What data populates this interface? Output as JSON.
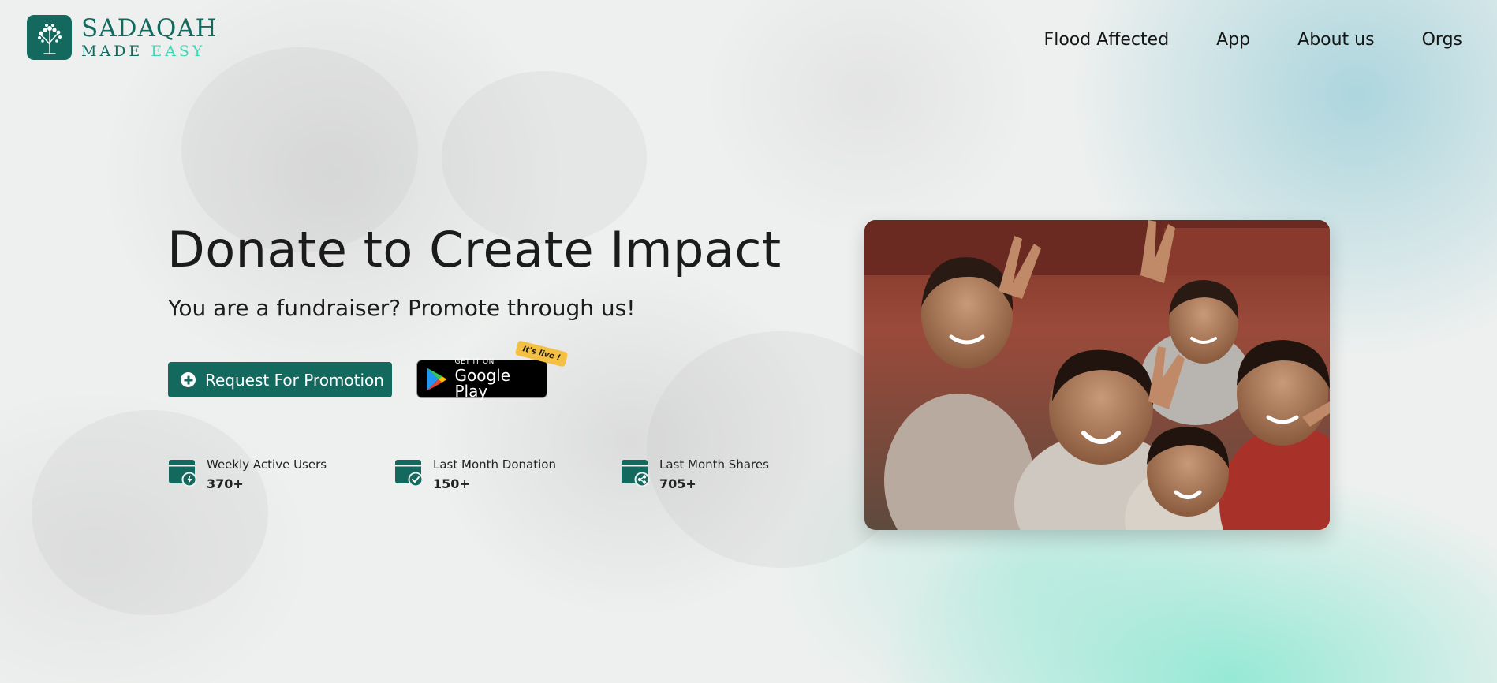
{
  "brand": {
    "name_line1": "SADAQAH",
    "name_made": "MADE",
    "name_easy": "EASY",
    "colors": {
      "primary": "#13695e",
      "accent": "#3fd6b6"
    },
    "logo_icon": "tree-icon"
  },
  "nav": {
    "items": [
      {
        "label": "Flood Affected"
      },
      {
        "label": "App"
      },
      {
        "label": "About us"
      },
      {
        "label": "Orgs"
      }
    ]
  },
  "hero": {
    "title": "Donate to Create Impact",
    "subtitle": "You are a fundraiser? Promote through us!",
    "promo_button": {
      "label": "Request For Promotion",
      "icon": "plus-circle-icon"
    },
    "google_play": {
      "small_text": "GET IT ON",
      "big_text": "Google Play",
      "badge": "It's live !"
    },
    "image_alt": "Group of smiling children making peace signs"
  },
  "stats": [
    {
      "label": "Weekly Active Users",
      "value": "370+",
      "icon": "wallet-bolt-icon"
    },
    {
      "label": "Last Month Donation",
      "value": "150+",
      "icon": "wallet-check-icon"
    },
    {
      "label": "Last Month Shares",
      "value": "705+",
      "icon": "wallet-share-icon"
    }
  ]
}
